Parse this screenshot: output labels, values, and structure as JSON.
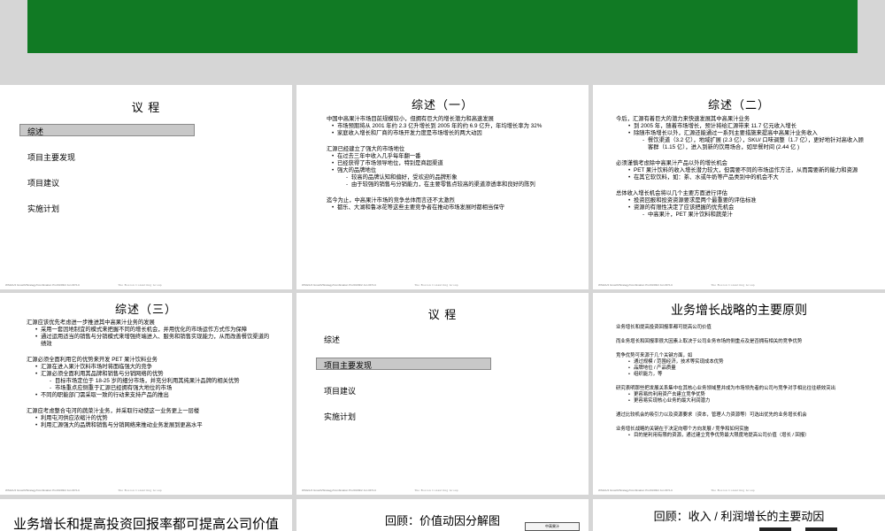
{
  "colors": {
    "banner": "#117a24",
    "highlight": "#c8c8c8"
  },
  "footer": {
    "left": "WSG/1/2 Growth/Strategy/Combination Pro/01/03/2 Jun 09 5-C",
    "center": "The Boston Consulting Group"
  },
  "slide1": {
    "title": "议  程",
    "items": [
      "综述",
      "项目主要发现",
      "项目建议",
      "实施计划"
    ]
  },
  "slide2": {
    "title": "综述（一）",
    "p1": "中国中高果汁市场目前规模较小，但拥有巨大的增长潜力和高速发展",
    "p1_b": [
      "市场预期将从 2001 年约 2.3 亿升增长到 2005 年的约 6.9 亿升，年均增长率为 32%",
      "家庭收入增长和厂商的市场开发力度是市场增长的两大动因"
    ],
    "p2": "汇源已经建立了强大的市场地位",
    "p2_b": [
      "在过去三年中收入几乎每年翻一番",
      "已经获得了市场领导地位，特别是商超渠道",
      "强大的品牌地位"
    ],
    "p2_bb": [
      "较高的品牌认知和偏好，受欢迎的品牌形象",
      "由于较强的销售与分销能力，在主要零售点较高的渠道渗透率和良好的陈列"
    ],
    "p3": "迄今为止，中高果汁市场的竞争总体而言还不太激烈",
    "p3_b": [
      "都乐、大湖和鲁冰花等这些主要竞争者在推动市场发展时都相当保守"
    ]
  },
  "slide3": {
    "title": "综述（二）",
    "p1": "今后，汇源有着巨大的潜力来快速发展其中高果汁业务",
    "p1_b": [
      "到 2005 年，随着市场增长，预计将给汇源带来 11.7 亿元收入增长",
      "除随市场增长以外，汇源还能通过一系列主要措施来提高中高果汁业务收入"
    ],
    "p1_bb": [
      "餐饮渠道（3.2 亿），地域扩展 (2.3 亿），SKU/ 口味调整（1.7 亿），更好地针对高收入顾客群（1.15 亿），进入到新的饮用场合，如早餐时间 (2.44 亿 )"
    ],
    "p2": "必须谨慎考虑除中高果汁产品以外的增长机会",
    "p2_b": [
      "PET 果汁饮料的收入增长潜力较大，但需要不同的市场运作方法，从而需要新的能力和资源",
      "在其它软饮料，如：茶、水或牛奶等产品类别中的机会不大"
    ],
    "p3": "总体收入增长机会将以几个主要方面进行评估",
    "p3_b": [
      "投资回报和投资资源要求是两个最重要的评估标准",
      "资源的有限性决定了应该把握的优先机会"
    ],
    "p3_bb": [
      "中高果汁，PET 果汁饮料和蔬菜汁"
    ]
  },
  "slide4": {
    "title": "综述（三）",
    "p1": "汇源应该优先考虑进一步推进其中高果汁业务的发展",
    "p1_b": [
      "采用一套因地制宜的模式来把握不同的增长机会，并用优化的市场运作方式作为保障",
      "通过运用适当的销售与分销模式来增强终端进入、服务和销售实现能力，从而改善餐饮渠道的绩效"
    ],
    "p2": "汇源必须全面利用它的优势来开发 PET 果汁饮料业务",
    "p2_b": [
      "汇源在进入果汁饮料市场时将面临强大的竞争",
      "汇源必须全面利用其品牌和销售与分销网络的优势"
    ],
    "p2_bb": [
      "目标市场定位于 18-25 岁的细分市场，并充分利用其纯果汁品牌的相关优势",
      "市场重点应侧重于汇源已经拥有强大地位的市场"
    ],
    "p2_b2": [
      "不同的职能部门需采取一致的行动来支持产品的推出"
    ],
    "p3": "汇源应考虑整合屯河的蔬菜汁业务，并采取行动使这一业务更上一层楼",
    "p3_b": [
      "利用屯河供应浓缩汁的优势",
      "利用汇源强大的品牌和销售与分销网络来推动业务发展到更高水平"
    ]
  },
  "slide5": {
    "title": "议  程",
    "items": [
      "综述",
      "项目主要发现",
      "项目建议",
      "实施计划"
    ]
  },
  "slide6": {
    "title": "业务增长战略的主要原则",
    "p1": "业务增长和提高投资回报率都可提高公司价值",
    "p2": "而业务增长和回报率很大因素上取决于公司业务市场的侧重点及是否拥有相关的竞争优势",
    "p3": "竞争优势可来源于几个关键方面，如",
    "p3_b": [
      "通过规模 / 范围经济，技术等实现成本优势",
      "品牌地位 / 产品质量",
      "组织能力，等"
    ],
    "p4": "研究表明那些把发展关系集中在其核心业务领域里并成为市场领先者的公司与竞争对手相比往往绩效突出",
    "p4_b": [
      "更容易的利用资产去建立竞争优势",
      "更容易实现核心业务的最大利润潜力"
    ],
    "p5": "通过比较机会的吸引力以及资源要求（资本，管理人力资源等）可选出优先的业务增长机会",
    "p6": "业务增长战略的关键在于决定向哪个方向发展 / 竞争和如何实施",
    "p6_b": [
      "目的是利用有限的资源，通过建立竞争优势最大限度地提高公司价值（增长 / 回报）"
    ]
  },
  "slide7": {
    "title": "业务增长和提高投资回报率都可提高公司价值"
  },
  "slide8": {
    "title": "回顾：价值动因分解图",
    "box_label": "中高果汁"
  },
  "slide9": {
    "title": "回顾：收入 / 利润增长的主要动因"
  }
}
